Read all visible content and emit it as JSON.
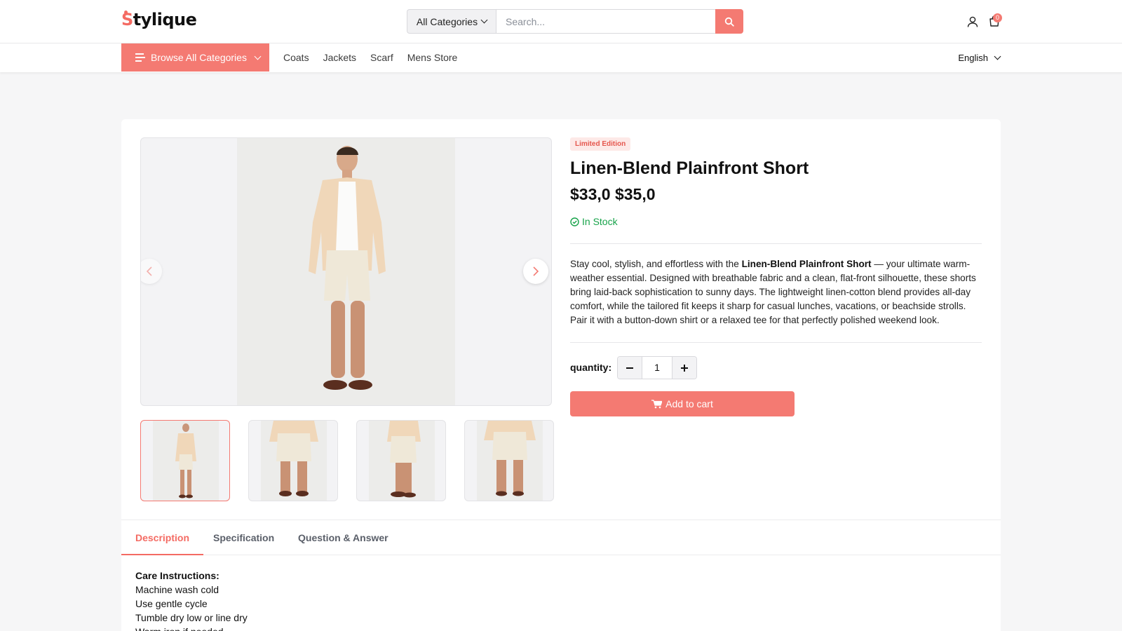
{
  "header": {
    "logo": "Stylique",
    "category_select": "All Categories",
    "search_placeholder": "Search...",
    "cart_count": "0"
  },
  "nav": {
    "browse_label": "Browse All Categories",
    "links": [
      "Coats",
      "Jackets",
      "Scarf",
      "Mens Store"
    ],
    "language": "English"
  },
  "product": {
    "badge": "Limited Edition",
    "title": "Linen-Blend Plainfront Short",
    "price": "$33,0 $35,0",
    "stock": "In Stock",
    "description_prefix": "Stay cool, stylish, and effortless with the ",
    "description_bold": "Linen-Blend Plainfront Short",
    "description_suffix": " — your ultimate warm-weather essential. Designed with breathable fabric and a clean, flat-front silhouette, these shorts bring laid-back sophistication to sunny days. The lightweight linen-cotton blend provides all-day comfort, while the tailored fit keeps it sharp for casual lunches, vacations, or beachside strolls. Pair it with a button-down shirt or a relaxed tee for that perfectly polished weekend look.",
    "quantity_label": "quantity:",
    "quantity_value": "1",
    "add_to_cart": "Add to cart"
  },
  "tabs": [
    "Description",
    "Specification",
    "Question & Answer"
  ],
  "care": {
    "title": "Care Instructions:",
    "items": [
      "Machine wash cold",
      "Use gentle cycle",
      "Tumble dry low or line dry",
      "Warm iron if needed"
    ]
  },
  "colors": {
    "accent": "#f47a72",
    "stock_green": "#17a34a"
  }
}
